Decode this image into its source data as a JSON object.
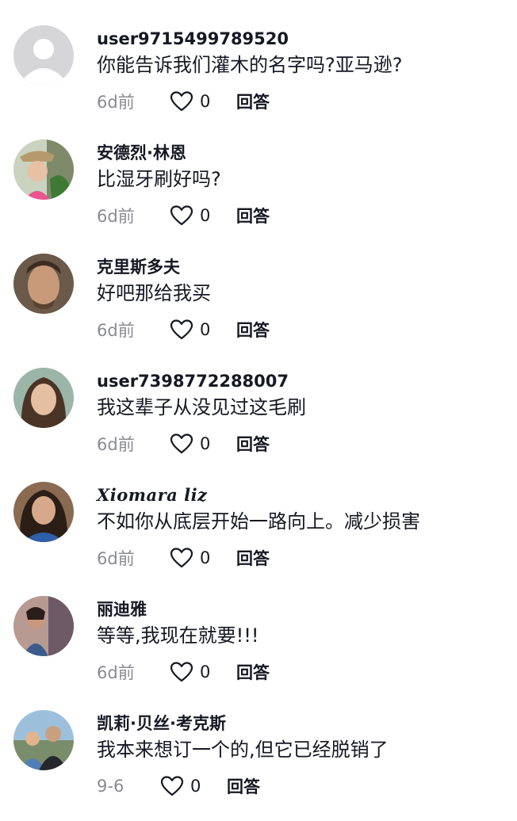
{
  "comments": [
    {
      "username": "user9715499789520",
      "text": "你能告诉我们灌木的名字吗?亚马逊?",
      "time": "6d前",
      "likes": "0",
      "reply_label": "回答"
    },
    {
      "username": "安德烈·林恩",
      "text": "比湿牙刷好吗?",
      "time": "6d前",
      "likes": "0",
      "reply_label": "回答"
    },
    {
      "username": "克里斯多夫",
      "text": "好吧那给我买",
      "time": "6d前",
      "likes": "0",
      "reply_label": "回答"
    },
    {
      "username": "user7398772288007",
      "text": "我这辈子从没见过这毛刷",
      "time": "6d前",
      "likes": "0",
      "reply_label": "回答"
    },
    {
      "username": "Xiomara liz",
      "text": "不如你从底层开始一路向上。减少损害",
      "time": "6d前",
      "likes": "0",
      "reply_label": "回答"
    },
    {
      "username": "丽迪雅",
      "text": "等等,我现在就要!!!",
      "time": "6d前",
      "likes": "0",
      "reply_label": "回答"
    },
    {
      "username": "凯莉·贝丝·考克斯",
      "text": "我本来想订一个的,但它已经脱销了",
      "time": "9-6",
      "likes": "0",
      "reply_label": "回答"
    }
  ],
  "icons": {
    "like": "heart-outline-icon"
  },
  "colors": {
    "text": "#161823",
    "secondary": "#8a8b91",
    "background": "#ffffff"
  }
}
